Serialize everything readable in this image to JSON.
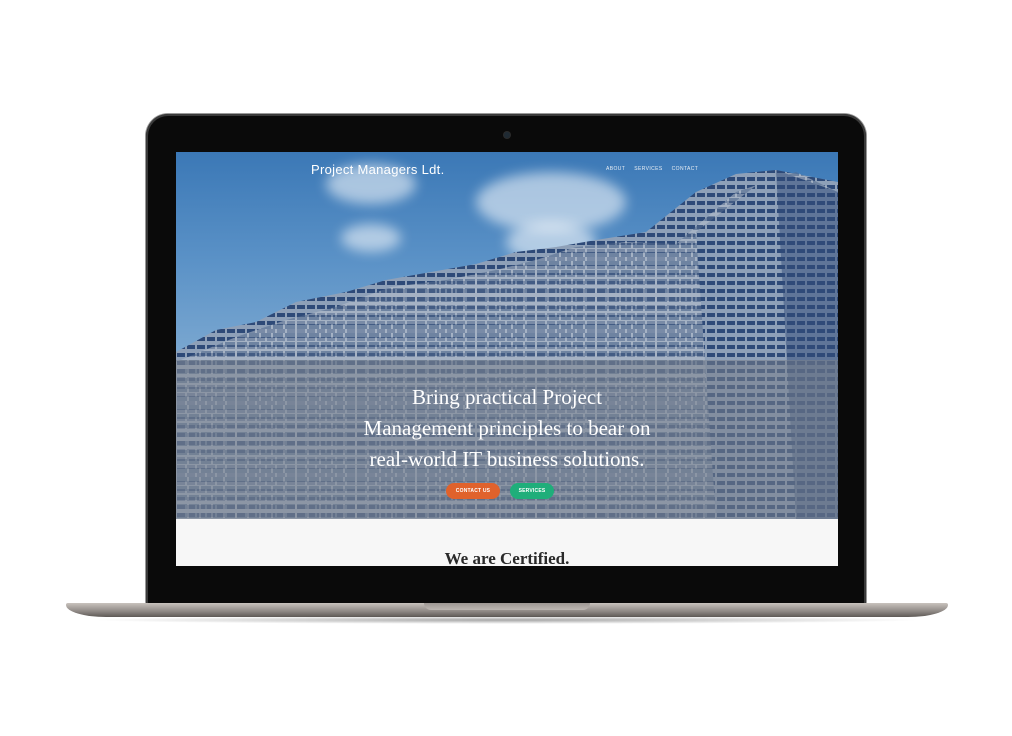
{
  "site": {
    "brand": "Project Managers Ldt.",
    "nav": [
      "ABOUT",
      "SERVICES",
      "CONTACT"
    ],
    "headline_lines": [
      "Bring practical Project",
      "Management principles to bear on",
      "real-world IT business solutions."
    ],
    "cta": {
      "contact": "CONTACT US",
      "services": "SERVICES"
    },
    "section_title": "We are Certified."
  },
  "colors": {
    "contact_button": "#e0622c",
    "services_button": "#1fae7a",
    "sky": "#3b78b6"
  }
}
